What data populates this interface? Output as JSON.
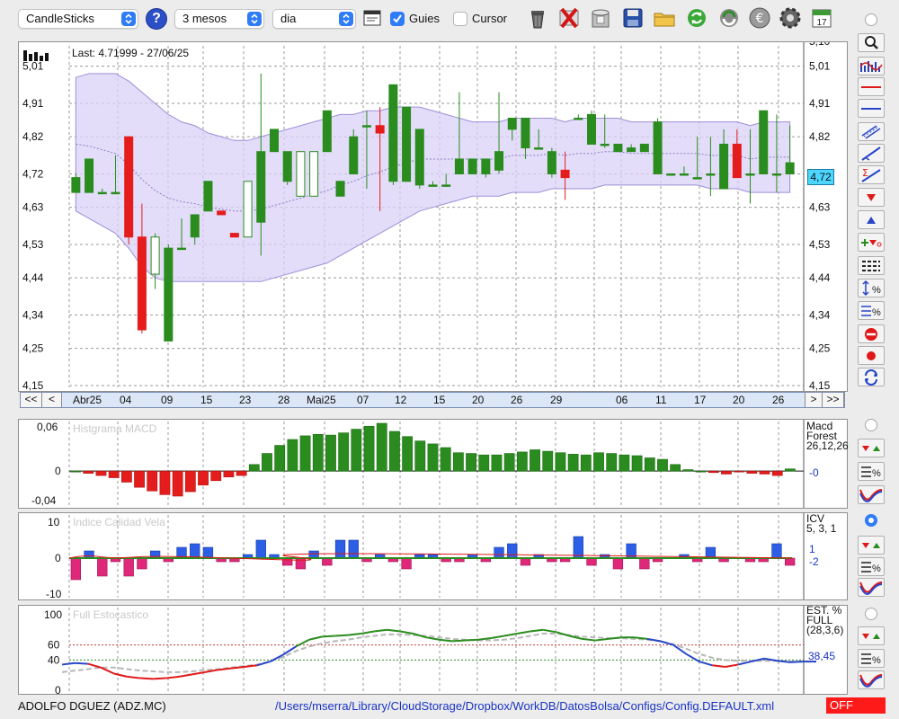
{
  "toolbar": {
    "chart_type": "CandleSticks",
    "period": "3 mesos",
    "interval": "dia",
    "help_label": "?",
    "grid_label": "Guies",
    "grid_checked": true,
    "cursor_label": "Cursor",
    "cursor_checked": false
  },
  "main_chart": {
    "last_label": "Last: 4.71999 - 27/06/25",
    "last_price_box": "4,72",
    "y_ticks": [
      "5,01",
      "4,91",
      "4,82",
      "4,72",
      "4,63",
      "4,53",
      "4,44",
      "4,34",
      "4,25",
      "4,15"
    ],
    "top_tick_partial": "5,10",
    "colors": {
      "up": "#2a8c1e",
      "down": "#e51c1c",
      "band": "#d9d1f7",
      "band_edge": "#9d8fd9"
    }
  },
  "navigation": {
    "first": "<<",
    "prev": "<",
    "next": ">",
    "last": ">>",
    "dates": [
      "Abr25",
      "04",
      "09",
      "15",
      "23",
      "28",
      "Mai25",
      "07",
      "12",
      "15",
      "20",
      "26",
      "29",
      "06",
      "11",
      "17",
      "20",
      "26"
    ]
  },
  "macd_panel": {
    "title": "Histgrama MACD",
    "y_ticks": [
      "0,06",
      "0",
      "-0,04"
    ],
    "legend_lines": [
      "Macd",
      "Forest",
      "26,12,26"
    ],
    "value": "-0"
  },
  "icv_panel": {
    "title": "Indice Calidad Vela",
    "y_ticks": [
      "10",
      "0",
      "-10"
    ],
    "legend_lines": [
      "ICV",
      "5, 3, 1"
    ],
    "value_a": "1",
    "value_b": "-2"
  },
  "stoch_panel": {
    "title": "Full Estocastico",
    "y_ticks": [
      "100",
      "60",
      "40",
      "0"
    ],
    "legend_lines": [
      "EST. %",
      "FULL",
      "(28,3,6)"
    ],
    "value": "38,45"
  },
  "footer": {
    "instrument": "ADOLFO DGUEZ (ADZ.MC)",
    "config_path": "/Users/mserra/Library/CloudStorage/Dropbox/WorkDB/DatosBolsa/Configs/Config.DEFAULT.xml",
    "status": "OFF"
  },
  "chart_data": [
    {
      "type": "candlestick",
      "title": "",
      "ylim": [
        4.15,
        5.06
      ],
      "series": [
        {
          "o": 4.67,
          "h": 4.72,
          "l": 4.67,
          "c": 4.71
        },
        {
          "o": 4.67,
          "h": 4.76,
          "l": 4.67,
          "c": 4.76
        },
        {
          "o": 4.67,
          "h": 4.68,
          "l": 4.67,
          "c": 4.67
        },
        {
          "o": 4.67,
          "h": 4.77,
          "l": 4.67,
          "c": 4.67
        },
        {
          "o": 4.82,
          "h": 4.82,
          "l": 4.53,
          "c": 4.55
        },
        {
          "o": 4.55,
          "h": 4.64,
          "l": 4.29,
          "c": 4.3
        },
        {
          "o": 4.45,
          "h": 4.56,
          "l": 4.41,
          "c": 4.55
        },
        {
          "o": 4.27,
          "h": 4.53,
          "l": 4.27,
          "c": 4.52
        },
        {
          "o": 4.52,
          "h": 4.6,
          "l": 4.52,
          "c": 4.52
        },
        {
          "o": 4.55,
          "h": 4.61,
          "l": 4.53,
          "c": 4.61
        },
        {
          "o": 4.62,
          "h": 4.7,
          "l": 4.62,
          "c": 4.7
        },
        {
          "o": 4.62,
          "h": 4.62,
          "l": 4.61,
          "c": 4.61
        },
        {
          "o": 4.56,
          "h": 4.56,
          "l": 4.55,
          "c": 4.55
        },
        {
          "o": 4.55,
          "h": 4.7,
          "l": 4.55,
          "c": 4.7
        },
        {
          "o": 4.59,
          "h": 4.99,
          "l": 4.5,
          "c": 4.78
        },
        {
          "o": 4.78,
          "h": 4.84,
          "l": 4.78,
          "c": 4.84
        },
        {
          "o": 4.7,
          "h": 4.78,
          "l": 4.69,
          "c": 4.78
        },
        {
          "o": 4.66,
          "h": 4.78,
          "l": 4.66,
          "c": 4.78
        },
        {
          "o": 4.66,
          "h": 4.78,
          "l": 4.66,
          "c": 4.78
        },
        {
          "o": 4.78,
          "h": 4.89,
          "l": 4.78,
          "c": 4.89
        },
        {
          "o": 4.66,
          "h": 4.7,
          "l": 4.66,
          "c": 4.7
        },
        {
          "o": 4.72,
          "h": 4.84,
          "l": 4.72,
          "c": 4.82
        },
        {
          "o": 4.85,
          "h": 4.89,
          "l": 4.68,
          "c": 4.85
        },
        {
          "o": 4.85,
          "h": 4.9,
          "l": 4.62,
          "c": 4.83
        },
        {
          "o": 4.7,
          "h": 4.96,
          "l": 4.69,
          "c": 4.96
        },
        {
          "o": 4.7,
          "h": 4.83,
          "l": 4.7,
          "c": 4.9
        },
        {
          "o": 4.69,
          "h": 4.84,
          "l": 4.68,
          "c": 4.84
        },
        {
          "o": 4.69,
          "h": 4.7,
          "l": 4.69,
          "c": 4.69
        },
        {
          "o": 4.69,
          "h": 4.72,
          "l": 4.69,
          "c": 4.69
        },
        {
          "o": 4.72,
          "h": 4.94,
          "l": 4.72,
          "c": 4.76
        },
        {
          "o": 4.72,
          "h": 4.76,
          "l": 4.72,
          "c": 4.76
        },
        {
          "o": 4.72,
          "h": 4.76,
          "l": 4.71,
          "c": 4.76
        },
        {
          "o": 4.73,
          "h": 4.94,
          "l": 4.72,
          "c": 4.78
        },
        {
          "o": 4.84,
          "h": 4.87,
          "l": 4.81,
          "c": 4.87
        },
        {
          "o": 4.79,
          "h": 4.85,
          "l": 4.76,
          "c": 4.87
        },
        {
          "o": 4.79,
          "h": 4.84,
          "l": 4.79,
          "c": 4.79
        },
        {
          "o": 4.72,
          "h": 4.79,
          "l": 4.71,
          "c": 4.78
        },
        {
          "o": 4.73,
          "h": 4.78,
          "l": 4.65,
          "c": 4.71
        },
        {
          "o": 4.87,
          "h": 4.88,
          "l": 4.87,
          "c": 4.87
        },
        {
          "o": 4.8,
          "h": 4.89,
          "l": 4.8,
          "c": 4.88
        },
        {
          "o": 4.8,
          "h": 4.88,
          "l": 4.79,
          "c": 4.8
        },
        {
          "o": 4.78,
          "h": 4.8,
          "l": 4.78,
          "c": 4.8
        },
        {
          "o": 4.78,
          "h": 4.8,
          "l": 4.78,
          "c": 4.79
        },
        {
          "o": 4.78,
          "h": 4.79,
          "l": 4.78,
          "c": 4.8
        },
        {
          "o": 4.72,
          "h": 4.87,
          "l": 4.72,
          "c": 4.86
        },
        {
          "o": 4.72,
          "h": 4.72,
          "l": 4.72,
          "c": 4.72
        },
        {
          "o": 4.72,
          "h": 4.74,
          "l": 4.72,
          "c": 4.72
        },
        {
          "o": 4.71,
          "h": 4.82,
          "l": 4.71,
          "c": 4.71
        },
        {
          "o": 4.72,
          "h": 4.82,
          "l": 4.66,
          "c": 4.72
        },
        {
          "o": 4.68,
          "h": 4.84,
          "l": 4.68,
          "c": 4.8
        },
        {
          "o": 4.8,
          "h": 4.84,
          "l": 4.71,
          "c": 4.71
        },
        {
          "o": 4.72,
          "h": 4.84,
          "l": 4.64,
          "c": 4.72
        },
        {
          "o": 4.72,
          "h": 4.89,
          "l": 4.72,
          "c": 4.89
        },
        {
          "o": 4.72,
          "h": 4.88,
          "l": 4.67,
          "c": 4.72
        },
        {
          "o": 4.72,
          "h": 4.85,
          "l": 4.72,
          "c": 4.75
        }
      ],
      "band_upper": [
        4.98,
        4.99,
        4.99,
        4.99,
        4.97,
        4.94,
        4.91,
        4.88,
        4.86,
        4.85,
        4.83,
        4.82,
        4.81,
        4.81,
        4.82,
        4.83,
        4.84,
        4.85,
        4.86,
        4.87,
        4.88,
        4.88,
        4.89,
        4.89,
        4.9,
        4.9,
        4.9,
        4.89,
        4.88,
        4.87,
        4.86,
        4.86,
        4.86,
        4.87,
        4.87,
        4.87,
        4.87,
        4.86,
        4.87,
        4.87,
        4.87,
        4.87,
        4.86,
        4.86,
        4.86,
        4.86,
        4.86,
        4.86,
        4.86,
        4.86,
        4.86,
        4.85,
        4.86,
        4.86,
        4.86
      ],
      "band_lower": [
        4.62,
        4.6,
        4.58,
        4.56,
        4.52,
        4.47,
        4.44,
        4.43,
        4.43,
        4.43,
        4.43,
        4.43,
        4.43,
        4.43,
        4.43,
        4.44,
        4.45,
        4.46,
        4.47,
        4.48,
        4.5,
        4.52,
        4.54,
        4.56,
        4.58,
        4.6,
        4.62,
        4.63,
        4.64,
        4.65,
        4.66,
        4.66,
        4.66,
        4.67,
        4.67,
        4.67,
        4.68,
        4.68,
        4.68,
        4.68,
        4.69,
        4.69,
        4.69,
        4.69,
        4.69,
        4.69,
        4.69,
        4.69,
        4.68,
        4.68,
        4.68,
        4.67,
        4.67,
        4.67,
        4.67
      ]
    },
    {
      "type": "bar",
      "title": "Histgrama MACD",
      "ylim": [
        -0.045,
        0.065
      ],
      "values": [
        0,
        -0.003,
        -0.006,
        -0.009,
        -0.015,
        -0.022,
        -0.027,
        -0.032,
        -0.034,
        -0.028,
        -0.019,
        -0.013,
        -0.008,
        -0.006,
        0.009,
        0.024,
        0.035,
        0.043,
        0.048,
        0.05,
        0.049,
        0.052,
        0.057,
        0.061,
        0.065,
        0.054,
        0.047,
        0.041,
        0.037,
        0.032,
        0.025,
        0.024,
        0.022,
        0.022,
        0.024,
        0.026,
        0.029,
        0.027,
        0.025,
        0.023,
        0.022,
        0.025,
        0.024,
        0.022,
        0.021,
        0.018,
        0.016,
        0.009,
        0.002,
        0,
        -0.002,
        -0.004,
        -0.001,
        -0.003,
        -0.004,
        -0.006,
        0.003
      ]
    },
    {
      "type": "bar",
      "title": "Indice Calidad Vela",
      "ylim": [
        -10.5,
        11
      ],
      "values": [
        -6,
        2,
        -5,
        -1,
        -5,
        -3,
        2,
        -1,
        3,
        4,
        3,
        -1,
        -1,
        1,
        5,
        1,
        -2,
        -3,
        2,
        -2,
        5,
        5,
        -1,
        1,
        -1,
        -3,
        1,
        1,
        -1,
        -1,
        1,
        -1,
        3,
        4,
        -2,
        1,
        -1,
        -1,
        6,
        -2,
        1,
        -3,
        4,
        -3,
        -1,
        0,
        1,
        -1,
        3,
        -1,
        0,
        -1,
        -1,
        4,
        -2
      ]
    },
    {
      "type": "line",
      "title": "Full Estocastico",
      "ylim": [
        0,
        100
      ],
      "series": [
        {
          "values": [
            34,
            36,
            35,
            30,
            22,
            18,
            16,
            15,
            16,
            18,
            21,
            24,
            27,
            29,
            31,
            33,
            38,
            47,
            58,
            67,
            71,
            72,
            73,
            75,
            78,
            80,
            78,
            75,
            70,
            67,
            65,
            66,
            67,
            69,
            72,
            75,
            78,
            80,
            77,
            72,
            68,
            66,
            68,
            70,
            70,
            68,
            65,
            60,
            48,
            38,
            33,
            31,
            34,
            38,
            42,
            39,
            37,
            38,
            38
          ]
        },
        {
          "values": [
            24,
            26,
            28,
            30,
            30,
            28,
            26,
            25,
            24,
            24,
            25,
            27,
            28,
            30,
            32,
            34,
            38,
            44,
            52,
            58,
            62,
            65,
            67,
            70,
            72,
            74,
            74,
            73,
            72,
            70,
            68,
            67,
            66,
            66,
            67,
            69,
            72,
            75,
            75,
            73,
            71,
            70,
            69,
            69,
            68,
            67,
            65,
            61,
            55,
            48,
            43,
            40,
            39,
            39,
            39,
            39,
            38,
            38,
            38
          ]
        }
      ]
    }
  ]
}
